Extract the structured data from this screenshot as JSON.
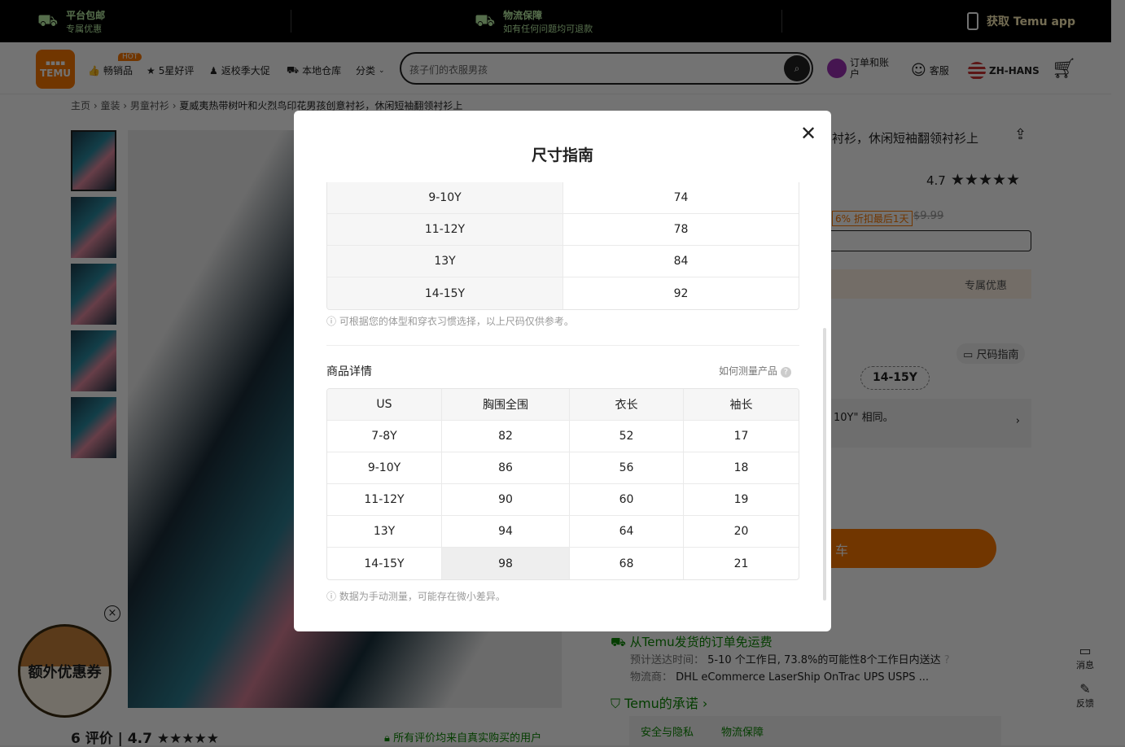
{
  "topbar": {
    "items": [
      {
        "title": "平台包邮",
        "sub": "专属优惠",
        "icon": "truck-icon"
      },
      {
        "title": "物流保障",
        "sub": "如有任何问题均可退款",
        "icon": "truck-check-icon"
      }
    ],
    "app": "获取 Temu app"
  },
  "nav": {
    "logo": "TEMU",
    "hot": "HOT",
    "links": [
      "畅销品",
      "5星好评",
      "返校季大促",
      "本地仓库",
      "分类"
    ],
    "search_placeholder": "孩子们的衣服男孩",
    "account": "订单和账户",
    "service": "客服",
    "language": "ZH-HANS"
  },
  "breadcrumb": [
    "主页",
    "童装",
    "男童衬衫",
    "夏威夷热带树叶和火烈鸟印花男孩创意衬衫，休闲短袖翻领衬衫上"
  ],
  "product": {
    "title_visible": "衬衫，休闲短袖翻领衬衫上",
    "rating": "4.7",
    "discount": "6% 折扣最后1天",
    "orig_price": "$9.99",
    "promo": "专属优惠",
    "size_guide": "尺码指南",
    "size_option": "14-15Y",
    "size_note": "10Y\" 相同。",
    "cart_visible": "车",
    "ship_free": "从Temu发货的订单免运费",
    "delivery_label": "预计送达时间：",
    "delivery": "5-10 个工作日, 73.8%的可能性8个工作日内送达",
    "carrier_label": "物流商：",
    "carriers": "DHL eCommerce  LaserShip  OnTrac  UPS  USPS ...",
    "promise": "Temu的承诺",
    "promise_tabs": [
      "安全与隐私",
      "物流保障"
    ],
    "reviews": "6 评价",
    "reviews_rating": "4.7",
    "reviews_verified": "所有评价均来自真实购买的用户"
  },
  "coupon": "额外优惠券",
  "side": {
    "msg": "消息",
    "feedback": "反馈"
  },
  "modal": {
    "title": "尺寸指南",
    "table1": [
      [
        "9-10Y",
        "74"
      ],
      [
        "11-12Y",
        "78"
      ],
      [
        "13Y",
        "84"
      ],
      [
        "14-15Y",
        "92"
      ]
    ],
    "note1": "ⓘ 可根据您的体型和穿衣习惯选择，以上尺码仅供参考。",
    "section": "商品详情",
    "how": "如何测量产品",
    "table2_header": [
      "US",
      "胸围全围",
      "衣长",
      "袖长"
    ],
    "table2": [
      [
        "7-8Y",
        "82",
        "52",
        "17"
      ],
      [
        "9-10Y",
        "86",
        "56",
        "18"
      ],
      [
        "11-12Y",
        "90",
        "60",
        "19"
      ],
      [
        "13Y",
        "94",
        "64",
        "20"
      ],
      [
        "14-15Y",
        "98",
        "68",
        "21"
      ]
    ],
    "note2": "ⓘ 数据为手动测量，可能存在微小差异。"
  },
  "colors": {
    "accent": "#fb7701",
    "green": "#0a8800"
  }
}
